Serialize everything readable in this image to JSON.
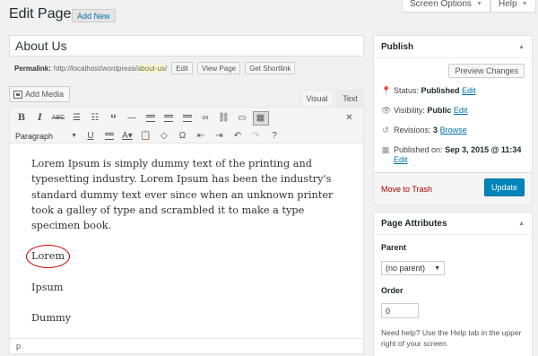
{
  "header": {
    "title": "Edit Page",
    "add_new": "Add New",
    "screen_options": "Screen Options",
    "help": "Help"
  },
  "post": {
    "title": "About Us",
    "permalink_label": "Permalink:",
    "permalink_base": "http://localhost/wordpress/",
    "permalink_slug": "about-us",
    "permalink_suffix": "/",
    "edit_btn": "Edit",
    "view_page_btn": "View Page",
    "shortlink_btn": "Get Shortlink"
  },
  "editor": {
    "add_media": "Add Media",
    "tab_visual": "Visual",
    "tab_text": "Text",
    "format_select": "Paragraph",
    "paragraph": "Lorem Ipsum is simply dummy text of the printing and typesetting industry. Lorem Ipsum has been the industry's standard dummy text ever since when an unknown printer took a galley of type and scrambled it to make a type specimen book.",
    "word1": "Lorem",
    "word2": "Ipsum",
    "word3": "Dummy",
    "status_path": "p",
    "toolbar_row1": [
      "bold-icon",
      "italic-icon",
      "strikethrough-icon",
      "bullet-list-icon",
      "numbered-list-icon",
      "blockquote-icon",
      "horizontal-line-icon",
      "align-left-icon",
      "align-center-icon",
      "align-right-icon",
      "link-icon",
      "unlink-icon",
      "read-more-icon",
      "toolbar-toggle-icon"
    ],
    "toolbar_row2": [
      "underline-icon",
      "justify-icon",
      "text-color-icon",
      "paste-text-icon",
      "clear-formatting-icon",
      "special-character-icon",
      "outdent-icon",
      "indent-icon",
      "undo-icon",
      "redo-icon",
      "help-icon"
    ]
  },
  "publish": {
    "heading": "Publish",
    "preview_btn": "Preview Changes",
    "status_label": "Status:",
    "status_value": "Published",
    "visibility_label": "Visibility:",
    "visibility_value": "Public",
    "revisions_label": "Revisions:",
    "revisions_value": "3",
    "browse": "Browse",
    "published_label": "Published on:",
    "published_value": "Sep 3, 2015 @ 11:34",
    "edit": "Edit",
    "trash": "Move to Trash",
    "update": "Update"
  },
  "attributes": {
    "heading": "Page Attributes",
    "parent_label": "Parent",
    "parent_value": "(no parent)",
    "order_label": "Order",
    "order_value": "0",
    "help_text": "Need help? Use the Help tab in the upper right of your screen."
  },
  "colors": {
    "accent": "#0073aa",
    "primary_button": "#0085ba",
    "danger": "#a00",
    "highlight_circle": "#cc0000"
  }
}
